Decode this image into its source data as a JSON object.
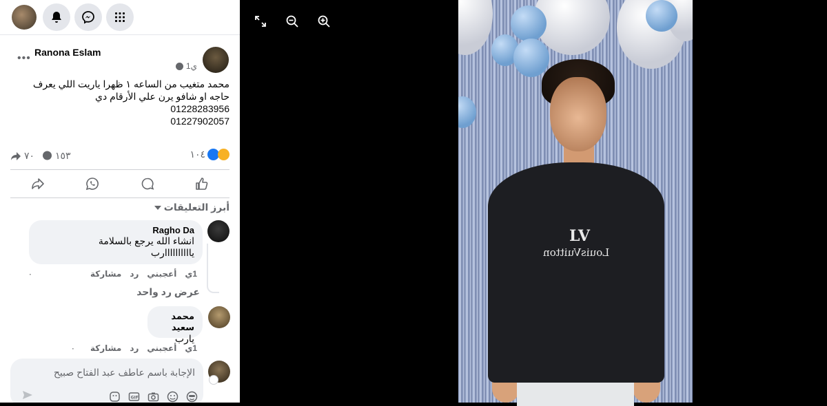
{
  "viewer": {
    "controls": [
      "fullscreen-icon",
      "zoom-out-icon",
      "zoom-in-icon"
    ]
  },
  "post": {
    "author": "Ranona Eslam",
    "time": "1ي",
    "text_lines": [
      "محمد متغيب من الساعه ١ ظهرا ياريت اللي يعرف حاجه او شافو يرن علي الأرقام دي"
    ],
    "phones": [
      "01228283956",
      "01227902057"
    ],
    "reactions_count": "١٠٤",
    "comments_count": "١٥٣",
    "shares_count": "٧٠"
  },
  "comments_section": {
    "sort_label": "أبرز التعليقات",
    "comments": [
      {
        "author": "Ragho Da",
        "lines": [
          "انشاء الله يرجع بالسلامة",
          "ياااااااااارب"
        ],
        "time": "1ي",
        "like": "أعجبني",
        "reply": "رد",
        "share": "مشاركة",
        "count": "٠"
      },
      {
        "author": "محمد سعيد",
        "lines": [
          "يارب"
        ],
        "time": "1ي",
        "like": "أعجبني",
        "reply": "رد",
        "share": "مشاركة",
        "count": "٠"
      }
    ],
    "view_reply": "عرض رد واحد",
    "reply_placeholder": "الإجابة باسم عاطف عبد الفتاح صبيح"
  },
  "photo": {
    "shirt_text": "LouisVuitton",
    "shirt_logo": "LV"
  },
  "colors": {
    "accent": "#1877f2",
    "bubble": "#f0f2f5",
    "muted": "#65676b"
  }
}
